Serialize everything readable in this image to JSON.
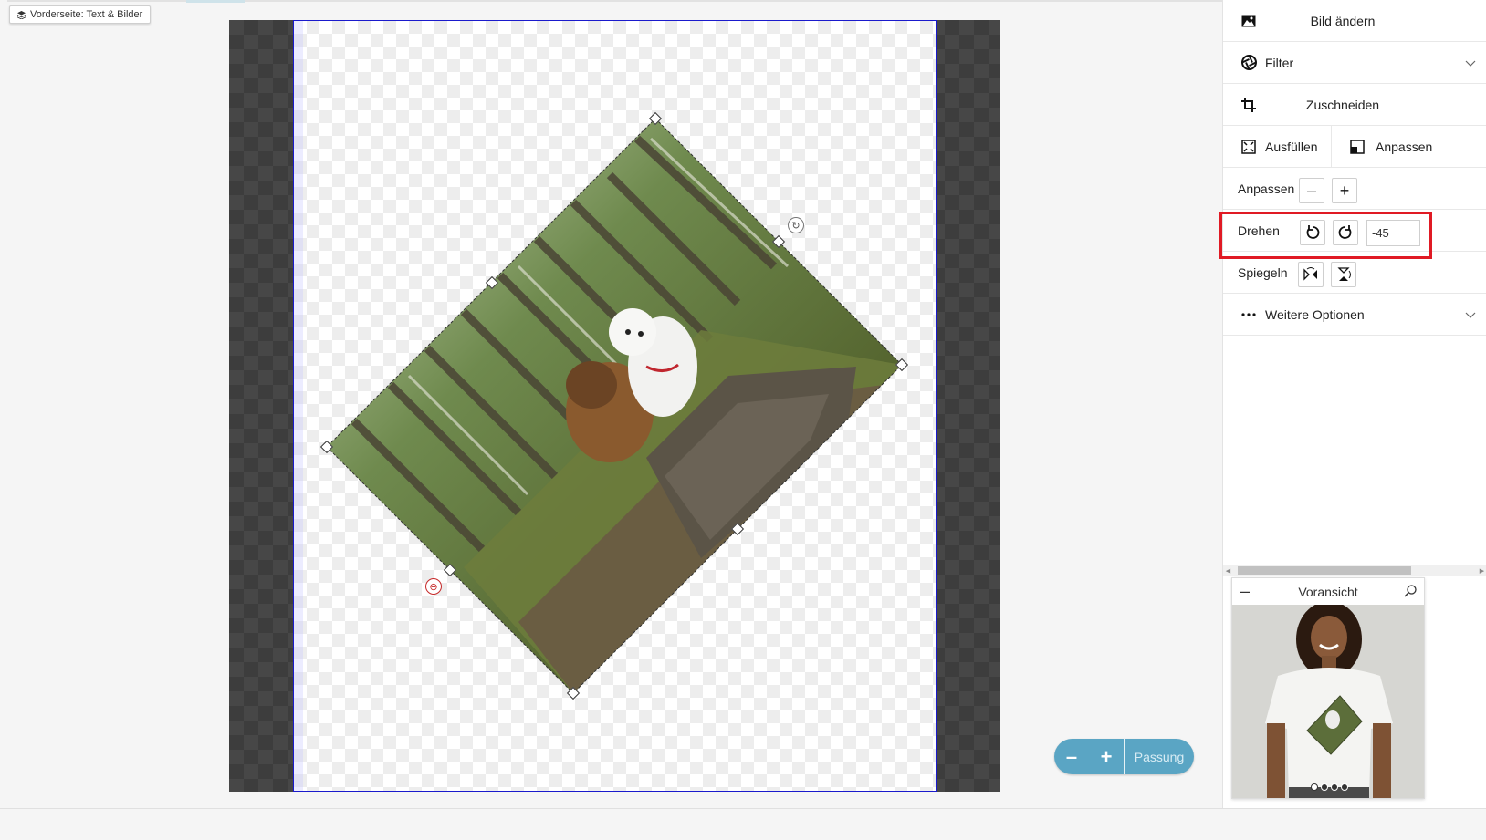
{
  "layer_chip": {
    "label": "Vorderseite: Text & Bilder"
  },
  "zoom": {
    "minus": "–",
    "plus": "+",
    "fit_label": "Passung"
  },
  "panel": {
    "change_image": "Bild ändern",
    "filter": "Filter",
    "crop": "Zuschneiden",
    "fill": "Ausfüllen",
    "fit": "Anpassen",
    "scale_label": "Anpassen",
    "scale_minus": "–",
    "scale_plus": "+",
    "rotate_label": "Drehen",
    "rotate_value": "-45",
    "mirror_label": "Spiegeln",
    "more_options": "Weitere Optionen"
  },
  "preview": {
    "title": "Voransicht",
    "minimize": "–",
    "pages": 4,
    "active_page": 0
  },
  "colors": {
    "accent": "#5aa5c4",
    "highlight": "#e01a24",
    "print_border": "#1a1acc"
  }
}
